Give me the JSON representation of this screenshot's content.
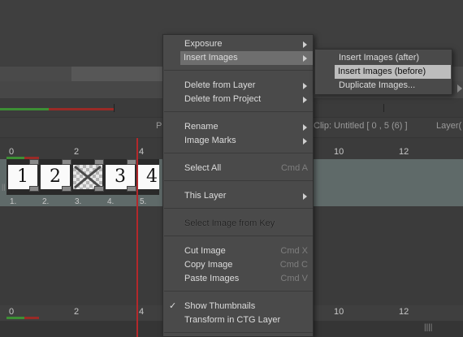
{
  "menu": {
    "items": [
      {
        "label": "Exposure",
        "submenu": true
      },
      {
        "label": "Insert Images",
        "submenu": true,
        "highlighted": true
      },
      {
        "label": "Delete from Layer",
        "submenu": true
      },
      {
        "label": "Delete from Project",
        "submenu": true
      },
      {
        "label": "Rename",
        "submenu": true
      },
      {
        "label": "Image Marks",
        "submenu": true
      },
      {
        "label": "Select All",
        "shortcut": "Cmd A"
      },
      {
        "label": "This Layer",
        "submenu": true
      },
      {
        "label": "Select Image from Key"
      },
      {
        "label": "Cut Image",
        "shortcut": "Cmd X"
      },
      {
        "label": "Copy Image",
        "shortcut": "Cmd C"
      },
      {
        "label": "Paste Images",
        "shortcut": "Cmd V"
      },
      {
        "label": "Show Thumbnails",
        "checked": true
      },
      {
        "label": "Transform in CTG Layer"
      }
    ]
  },
  "submenu": {
    "items": [
      {
        "label": "Insert Images (after)"
      },
      {
        "label": "Insert Images (before)",
        "highlighted": true
      },
      {
        "label": "Duplicate Images..."
      }
    ]
  },
  "info": {
    "p_label": "P",
    "clip": "Clip: Untitled [ 0 , 5  (6) ]",
    "layer": "Layer("
  },
  "timeline": {
    "frame_numbers_left": [
      "0",
      "2",
      "4"
    ],
    "frame_numbers_right": [
      "10",
      "12"
    ],
    "cells": [
      "1",
      "2",
      "",
      "3",
      "4"
    ],
    "cell_labels": [
      "1.",
      "2.",
      "3.",
      "4.",
      "5."
    ]
  },
  "colors": {
    "menu_bg": "#4a4a4a",
    "highlight": "#6e6e6e",
    "submenu_highlight": "#bdbdbd",
    "playhead": "#b3282b",
    "layer_row": "#5f6a69"
  }
}
